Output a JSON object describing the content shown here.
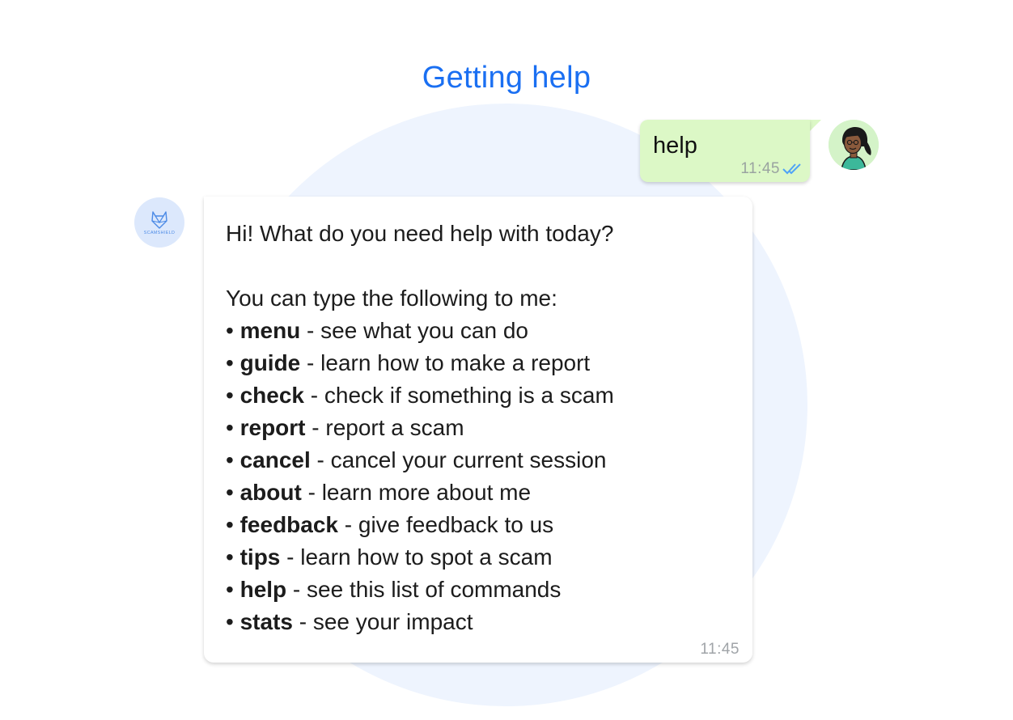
{
  "page": {
    "title": "Getting help"
  },
  "user_message": {
    "text": "help",
    "time": "11:45",
    "status_icon": "double-check-icon"
  },
  "bot": {
    "avatar_text": "SCAMSHIELD",
    "greeting": "Hi! What do you need help with today?",
    "intro": "You can type the following to me:",
    "bullet": "•",
    "commands": [
      {
        "command": "menu",
        "desc": " - see what you can do"
      },
      {
        "command": "guide",
        "desc": " - learn how to make a report"
      },
      {
        "command": "check",
        "desc": " - check if something is a scam"
      },
      {
        "command": "report",
        "desc": " - report a scam"
      },
      {
        "command": "cancel",
        "desc": " - cancel your current session"
      },
      {
        "command": "about",
        "desc": " - learn more about me"
      },
      {
        "command": "feedback",
        "desc": " - give feedback to us"
      },
      {
        "command": "tips",
        "desc": " - learn how to spot a scam"
      },
      {
        "command": "help",
        "desc": " - see this list of commands"
      },
      {
        "command": "stats",
        "desc": " - see your impact"
      }
    ],
    "time": "11:45"
  },
  "colors": {
    "title": "#1a6ff2",
    "user_bubble": "#dcf8c6",
    "background_circle": "#eef4fe",
    "read_ticks": "#4fa3f7"
  }
}
